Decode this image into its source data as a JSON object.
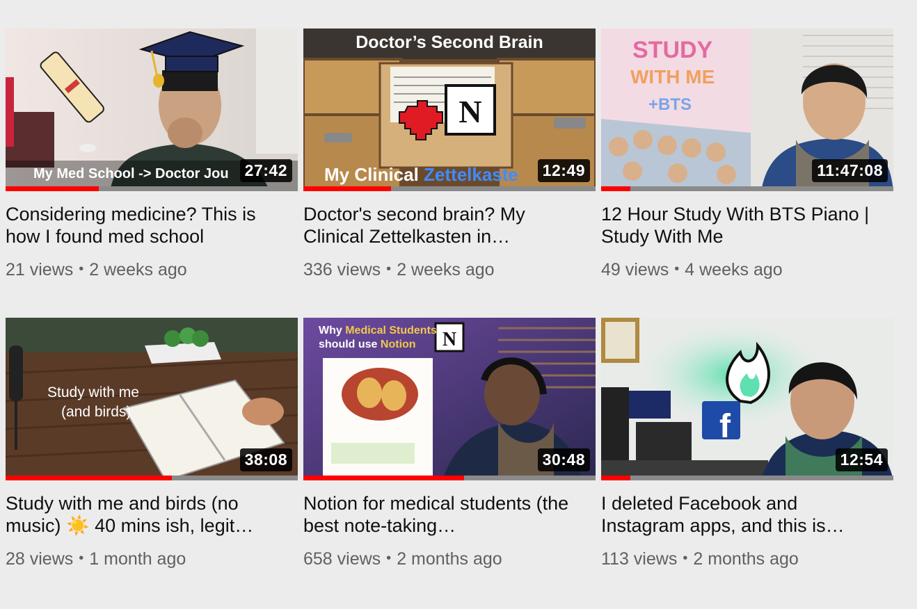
{
  "videos": [
    {
      "title": "Considering medicine? This is how I found med school",
      "views": "21 views",
      "age": "2 weeks ago",
      "duration": "27:42",
      "progress": 0.32,
      "thumb_caption": "My Med School -> Doctor Jou"
    },
    {
      "title": "Doctor's second brain? My Clinical Zettelkasten in…",
      "views": "336 views",
      "age": "2 weeks ago",
      "duration": "12:49",
      "progress": 0.3,
      "thumb_top": "Doctor’s Second Brain",
      "thumb_caption_a": "My Clinical ",
      "thumb_caption_b": "Zettelkaste"
    },
    {
      "title": "12 Hour Study With BTS Piano | Study With Me",
      "views": "49 views",
      "age": "4 weeks ago",
      "duration": "11:47:08",
      "progress": 0.1,
      "thumb_line1": "STUDY",
      "thumb_line2": "WITH ME",
      "thumb_line3": "+BTS"
    },
    {
      "title": "Study with me and birds (no music) ☀️ 40 mins ish, legit…",
      "views": "28 views",
      "age": "1 month ago",
      "duration": "38:08",
      "progress": 0.57,
      "thumb_line1": "Study with me",
      "thumb_line2": "(and birds)"
    },
    {
      "title": "Notion for medical students (the best note-taking…",
      "views": "658 views",
      "age": "2 months ago",
      "duration": "30:48",
      "progress": 0.55,
      "thumb_line1a": "Why ",
      "thumb_line1b": "Medical Students",
      "thumb_line2a": "should use ",
      "thumb_line2b": "Notion"
    },
    {
      "title": "I deleted Facebook and Instagram apps, and this is…",
      "views": "113 views",
      "age": "2 months ago",
      "duration": "12:54",
      "progress": 0.1
    }
  ],
  "colors": {
    "progress": "#ff0000",
    "progress_track": "#8a8a8a",
    "background": "#ececec",
    "title": "#0f0f0f",
    "meta": "#606060"
  }
}
